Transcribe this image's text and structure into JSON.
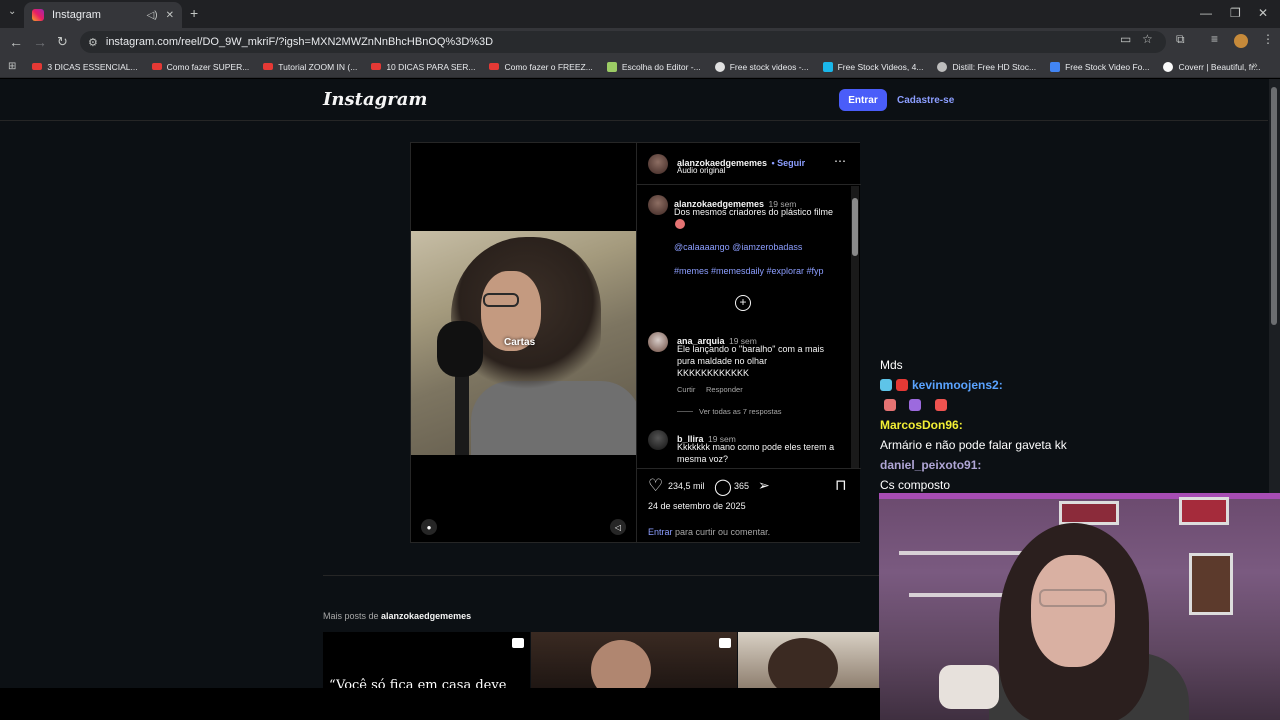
{
  "browser": {
    "tab_title": "Instagram",
    "url": "instagram.com/reel/DO_9W_mkriF/?igsh=MXN2MWZnNnBhcHBnOQ%3D%3D",
    "bookmarks": [
      {
        "label": "3 DICAS ESSENCIAL...",
        "icon": "youtube-icon"
      },
      {
        "label": "Como fazer SUPER...",
        "icon": "youtube-icon"
      },
      {
        "label": "Tutorial ZOOM IN (...",
        "icon": "youtube-icon"
      },
      {
        "label": "10 DICAS PARA SER...",
        "icon": "youtube-icon"
      },
      {
        "label": "Como fazer o FREEZ...",
        "icon": "youtube-icon"
      },
      {
        "label": "Escolha do Editor -...",
        "icon": "px-icon"
      },
      {
        "label": "Free stock videos -...",
        "icon": "pexels-icon"
      },
      {
        "label": "Free Stock Videos, 4...",
        "icon": "vimeo-icon"
      },
      {
        "label": "Distill: Free HD Stoc...",
        "icon": "distill-icon"
      },
      {
        "label": "Free Stock Video Fo...",
        "icon": "doc-icon"
      },
      {
        "label": "Coverr | Beautiful, fr...",
        "icon": "coverr-icon"
      }
    ]
  },
  "header": {
    "logo": "Instagram",
    "login_label": "Entrar",
    "signup_label": "Cadastre-se"
  },
  "post": {
    "video_caption": "Cartas",
    "author": "alanzokaedgememes",
    "follow_label": "• Seguir",
    "audio_label": "Áudio original",
    "caption": {
      "user": "alanzokaedgememes",
      "time": "19 sem",
      "text": "Dos mesmos criadores do plástico filme",
      "mentions": "@calaaaango @iamzerobadass",
      "hashtags": "#memes #memesdaily #explorar #fyp"
    },
    "comments": [
      {
        "user": "ana_arquia",
        "time": "19 sem",
        "line1": "Ele lançando o \"baralho\" com a mais",
        "line2": "pura maldade no olhar",
        "line3": "KKKKKKKKKKKK",
        "like_label": "Curtir",
        "reply_label": "Responder",
        "view_replies": "Ver todas as 7 respostas"
      },
      {
        "user": "b_llira",
        "time": "19 sem",
        "line1": "Kkkkkkk mano como pode eles terem a",
        "line2": "mesma voz?"
      }
    ],
    "likes": "234,5 mil",
    "comment_count": "365",
    "date": "24 de setembro de 2025",
    "login_prompt_link": "Entrar",
    "login_prompt_text": "para curtir ou comentar."
  },
  "more_posts": {
    "prefix": "Mais posts de",
    "user": "alanzokaedgememes",
    "first_thumb_text": "“Você só fica em casa deve"
  },
  "chat": [
    {
      "user": "",
      "text": "Mds",
      "color": "#ffffff"
    },
    {
      "user": "kevinmoojens2:",
      "text": "",
      "color": "#5aa3ff"
    },
    {
      "user": "MarcosDon96:",
      "text": "Armário e não pode falar gaveta kk",
      "color": "#f2ef35"
    },
    {
      "user": "daniel_peixoto91:",
      "text": "Cs composto",
      "color": "#b0a6d6"
    }
  ],
  "colors": {
    "accent": "#4a5df9",
    "link": "#8c9eff",
    "page_bg": "#0c1014"
  }
}
